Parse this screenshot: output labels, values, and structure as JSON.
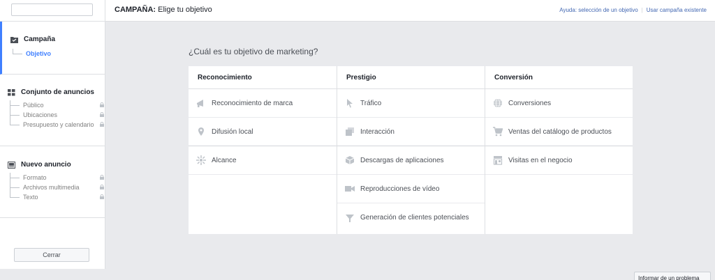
{
  "header": {
    "title_bold": "CAMPAÑA:",
    "title_rest": " Elige tu objetivo",
    "help_link": "Ayuda: selección de un objetivo",
    "use_existing_link": "Usar campaña existente"
  },
  "sidebar": {
    "search_value": "",
    "campaign": {
      "label": "Campaña",
      "items": [
        "Objetivo"
      ]
    },
    "adset": {
      "label": "Conjunto de anuncios",
      "items": [
        "Público",
        "Ubicaciones",
        "Presupuesto y calendario"
      ]
    },
    "ad": {
      "label": "Nuevo anuncio",
      "items": [
        "Formato",
        "Archivos multimedia",
        "Texto"
      ]
    },
    "close_label": "Cerrar"
  },
  "main": {
    "question": "¿Cuál es tu objetivo de marketing?",
    "columns": [
      {
        "title": "Reconocimiento",
        "options": [
          "Reconocimiento de marca",
          "Difusión local",
          "Alcance"
        ]
      },
      {
        "title": "Prestigio",
        "options": [
          "Tráfico",
          "Interacción",
          "Descargas de aplicaciones",
          "Reproducciones de vídeo",
          "Generación de clientes potenciales"
        ]
      },
      {
        "title": "Conversión",
        "options": [
          "Conversiones",
          "Ventas del catálogo de productos",
          "Visitas en el negocio"
        ]
      }
    ]
  },
  "footer": {
    "report_label": "Informar de un problema"
  },
  "colors": {
    "accent": "#4080ff",
    "link": "#4267b2",
    "icon": "#bec3c9"
  }
}
